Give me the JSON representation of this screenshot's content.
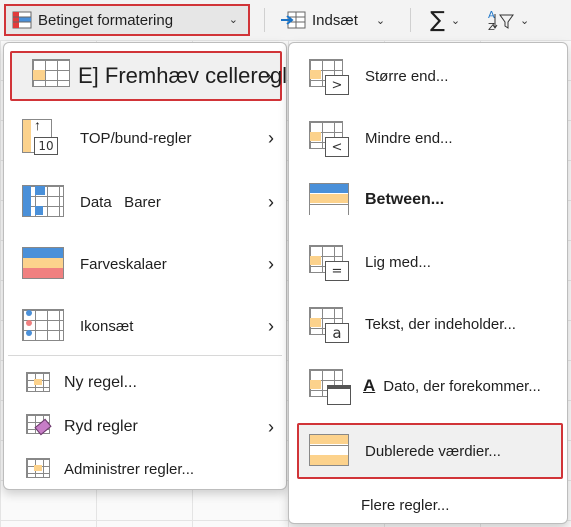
{
  "ribbon": {
    "conditional_formatting": "Betinget formatering",
    "insert": "Indsæt"
  },
  "main_menu": {
    "items": [
      {
        "label": "E] Fremhæv celleregler",
        "icon": "highlight-cells-rules-icon",
        "has_submenu": true
      },
      {
        "label": "TOP/bund-regler",
        "icon": "top-bottom-rules-icon",
        "icon_text": "10",
        "has_submenu": true
      },
      {
        "label": "Data   Barer",
        "icon": "data-bars-icon",
        "has_submenu": true
      },
      {
        "label": "Farveskalaer",
        "icon": "color-scales-icon",
        "has_submenu": true
      },
      {
        "label": "Ikonsæt",
        "icon": "icon-sets-icon",
        "has_submenu": true
      },
      {
        "label": "Ny regel...",
        "icon": "new-rule-icon",
        "has_submenu": false
      },
      {
        "label": "Ryd regler",
        "icon": "clear-rules-icon",
        "has_submenu": true
      },
      {
        "label": "Administrer regler...",
        "icon": "manage-rules-icon",
        "has_submenu": false
      }
    ]
  },
  "sub_menu": {
    "items": [
      {
        "label": "Større end...",
        "icon": "greater-than-icon",
        "symbol": ">"
      },
      {
        "label": "Mindre end...",
        "icon": "less-than-icon",
        "symbol": "<"
      },
      {
        "label": "Between...",
        "icon": "between-icon"
      },
      {
        "label": "Lig med...",
        "icon": "equal-to-icon",
        "symbol": "="
      },
      {
        "label": "Tekst, der indeholder...",
        "icon": "text-contains-icon",
        "symbol": "a"
      },
      {
        "label": "Dato, der forekommer...",
        "icon": "date-occurring-icon",
        "prefix": "A"
      },
      {
        "label": "Dublerede værdier...",
        "icon": "duplicate-values-icon"
      },
      {
        "label": "Flere regler...",
        "icon": ""
      }
    ]
  },
  "colors": {
    "highlight_border": "#d13438",
    "cell_orange": "#fcd28c",
    "cell_blue": "#4a90d9",
    "cell_red": "#f08080"
  }
}
